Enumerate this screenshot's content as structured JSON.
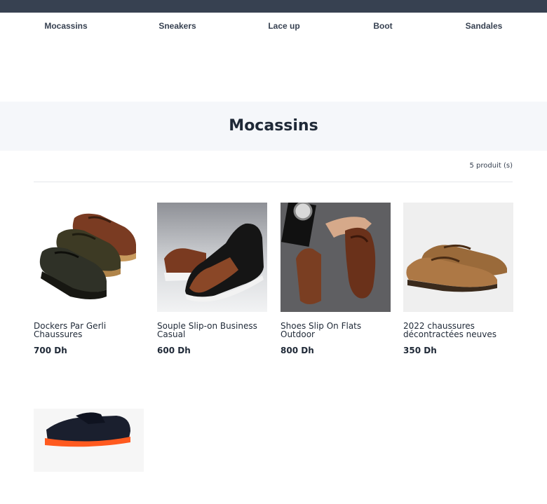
{
  "nav": {
    "items": [
      {
        "label": "Mocassins"
      },
      {
        "label": "Sneakers"
      },
      {
        "label": "Lace up"
      },
      {
        "label": "Boot"
      },
      {
        "label": "Sandales"
      }
    ]
  },
  "page": {
    "title": "Mocassins",
    "count_text": "5 produit (s)"
  },
  "products": [
    {
      "name": "Dockers Par Gerli Chaussures",
      "price": "700 Dh",
      "image": "three-boat-shoes-photo"
    },
    {
      "name": "Souple Slip-on Business Casual",
      "price": "600 Dh",
      "image": "slip-on-shoe-photo"
    },
    {
      "name": "Shoes Slip On Flats Outdoor",
      "price": "800 Dh",
      "image": "brown-loafers-worn-photo"
    },
    {
      "name": "2022 chaussures décontractées neuves",
      "price": "350 Dh",
      "image": "brown-derby-shoes-photo"
    },
    {
      "name": "",
      "price": "",
      "image": "navy-loafer-orange-sole-photo"
    }
  ]
}
